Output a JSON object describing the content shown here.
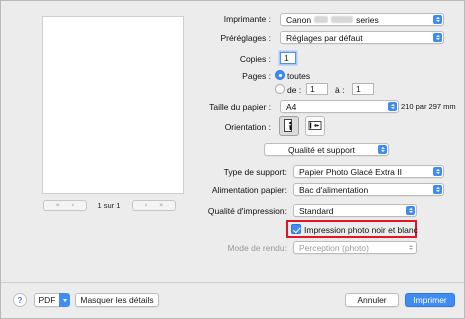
{
  "printer": {
    "label": "Imprimante :",
    "value_prefix": "Canon",
    "value_suffix": "series"
  },
  "presets": {
    "label": "Préréglages :",
    "value": "Réglages par défaut"
  },
  "copies": {
    "label": "Copies :",
    "value": "1"
  },
  "pages": {
    "label": "Pages :",
    "all_label": "toutes",
    "from_label": "de :",
    "from_value": "1",
    "to_label": "à :",
    "to_value": "1",
    "selected": "toutes"
  },
  "paper_size": {
    "label": "Taille du papier :",
    "value": "A4",
    "dimensions": "210 par 297 mm"
  },
  "orientation": {
    "label": "Orientation :",
    "selected": "portrait",
    "portrait_icon": "portrait-orientation-icon",
    "landscape_icon": "landscape-orientation-icon"
  },
  "section_popup": {
    "value": "Qualité et support"
  },
  "media_type": {
    "label": "Type de support:",
    "value": "Papier Photo Glacé Extra II"
  },
  "paper_source": {
    "label": "Alimentation papier:",
    "value": "Bac d'alimentation"
  },
  "print_quality": {
    "label": "Qualité d'impression:",
    "value": "Standard"
  },
  "grayscale": {
    "label": "Impression photo noir et blanc",
    "checked": true
  },
  "render_mode": {
    "label": "Mode de rendu:",
    "value": "Perception (photo)",
    "enabled": false
  },
  "preview": {
    "page_counter": "1 sur 1",
    "first_icon": "«",
    "prev_icon": "‹",
    "next_icon": "›",
    "last_icon": "»"
  },
  "footer": {
    "help_icon": "?",
    "pdf_label": "PDF",
    "hide_details_label": "Masquer les détails",
    "cancel_label": "Annuler",
    "print_label": "Imprimer"
  },
  "colors": {
    "accent": "#3f8cf3",
    "highlight_border": "#e0162b",
    "window_bg": "#ececec"
  }
}
